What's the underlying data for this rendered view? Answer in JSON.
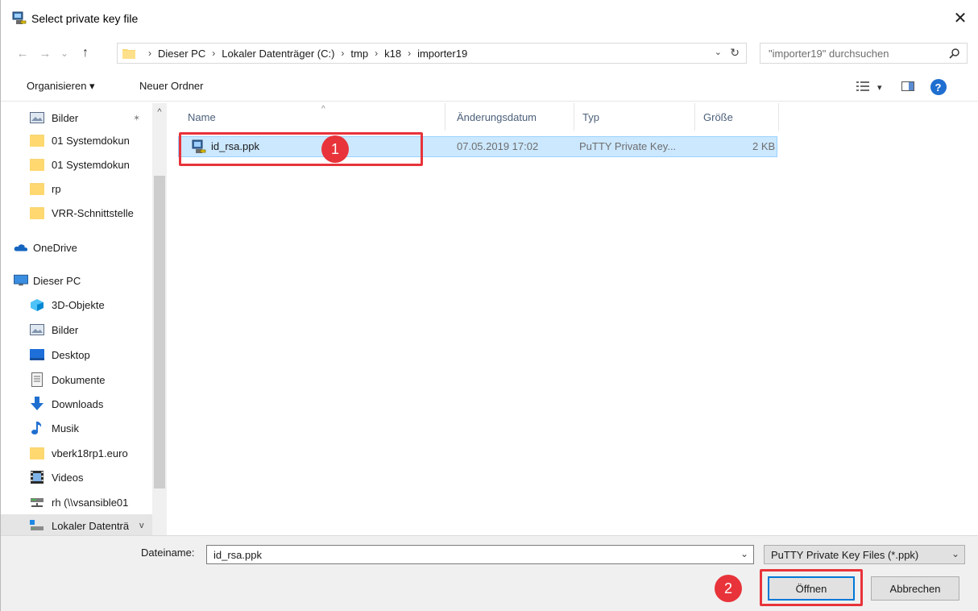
{
  "window": {
    "title": "Select private key file",
    "close_glyph": "✕"
  },
  "nav": {
    "back_glyph": "←",
    "forward_glyph": "→",
    "recent_glyph": "⌄",
    "up_glyph": "↑"
  },
  "address": {
    "separator": "›",
    "crumbs": [
      "Dieser PC",
      "Lokaler Datenträger (C:)",
      "tmp",
      "k18",
      "importer19"
    ],
    "dropdown_glyph": "⌄",
    "refresh_glyph": "↻"
  },
  "search": {
    "placeholder": "\"importer19\" durchsuchen"
  },
  "toolbar": {
    "organize_label": "Organisieren ▾",
    "new_folder_label": "Neuer Ordner",
    "view_dropdown_glyph": "▾",
    "help_glyph": "?"
  },
  "sidebar": {
    "top_arrow": "^",
    "bottom_arrow": "v",
    "pin_glyph": "✶",
    "items": [
      {
        "label": "Bilder",
        "icon": "pictures-icon"
      },
      {
        "label": "01 Systemdokun",
        "icon": "folder-icon"
      },
      {
        "label": "01 Systemdokun",
        "icon": "folder-icon"
      },
      {
        "label": "rp",
        "icon": "folder-icon"
      },
      {
        "label": "VRR-Schnittstelle",
        "icon": "folder-icon"
      },
      {
        "label": "OneDrive",
        "icon": "onedrive-icon"
      },
      {
        "label": "Dieser PC",
        "icon": "this-pc-icon"
      },
      {
        "label": "3D-Objekte",
        "icon": "3d-objects-icon"
      },
      {
        "label": "Bilder",
        "icon": "pictures-icon"
      },
      {
        "label": "Desktop",
        "icon": "desktop-icon"
      },
      {
        "label": "Dokumente",
        "icon": "documents-icon"
      },
      {
        "label": "Downloads",
        "icon": "downloads-icon"
      },
      {
        "label": "Musik",
        "icon": "music-icon"
      },
      {
        "label": "vberk18rp1.euro",
        "icon": "folder-icon"
      },
      {
        "label": "Videos",
        "icon": "videos-icon"
      },
      {
        "label": "rh (\\\\vsansible01",
        "icon": "network-drive-icon"
      },
      {
        "label": "Lokaler Datenträ",
        "icon": "local-drive-icon"
      }
    ]
  },
  "columns": {
    "name": "Name",
    "date": "Änderungsdatum",
    "type": "Typ",
    "size": "Größe",
    "sort_glyph": "^"
  },
  "files": [
    {
      "name": "id_rsa.ppk",
      "date": "07.05.2019 17:02",
      "type": "PuTTY Private Key...",
      "size": "2 KB"
    }
  ],
  "annotations": {
    "step1": "1",
    "step2": "2"
  },
  "bottom": {
    "filename_label": "Dateiname:",
    "filename_value": "id_rsa.ppk",
    "filename_drop": "⌄",
    "filter_value": "PuTTY Private Key Files (*.ppk)",
    "filter_drop": "⌄",
    "open_label": "Öffnen",
    "cancel_label": "Abbrechen"
  },
  "colors": {
    "selection": "#cce8ff",
    "annotation_red": "#e8333a",
    "accent_blue": "#0078d7"
  }
}
